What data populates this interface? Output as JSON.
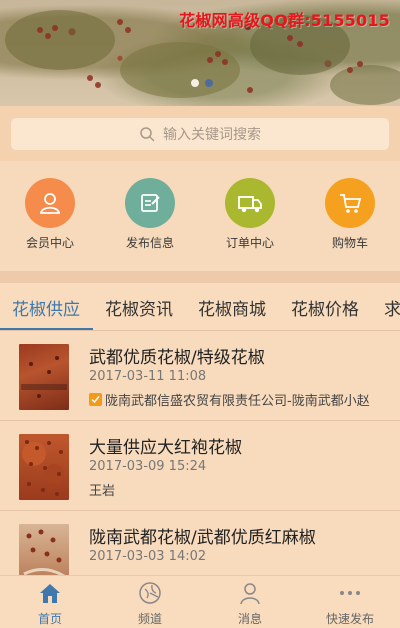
{
  "banner": {
    "text": "花椒网高级QQ群:5155015",
    "dots": [
      {
        "active": false
      },
      {
        "active": true
      }
    ]
  },
  "search": {
    "placeholder": "输入关键词搜索"
  },
  "quick_actions": [
    {
      "label": "会员中心",
      "icon": "user-icon",
      "color": "#f58c4c"
    },
    {
      "label": "发布信息",
      "icon": "edit-icon",
      "color": "#6fae9a"
    },
    {
      "label": "订单中心",
      "icon": "truck-icon",
      "color": "#a9b82e"
    },
    {
      "label": "购物车",
      "icon": "cart-icon",
      "color": "#f6a01f"
    }
  ],
  "tabs": {
    "items": [
      "花椒供应",
      "花椒资讯",
      "花椒商城",
      "花椒价格",
      "求"
    ],
    "active_index": 0,
    "accent": "#3e78ad"
  },
  "list": [
    {
      "title": "武都优质花椒/特级花椒",
      "date": "2017-03-11 11:08",
      "meta": "陇南武都信盛农贸有限责任公司-陇南武都小赵",
      "verified": true
    },
    {
      "title": "大量供应大红袍花椒",
      "date": "2017-03-09 15:24",
      "meta": "王岩",
      "verified": false
    },
    {
      "title": "陇南武都花椒/武都优质红麻椒",
      "date": "2017-03-03 14:02",
      "meta": "",
      "verified": false
    }
  ],
  "bottom_nav": [
    {
      "label": "首页",
      "icon": "home-icon",
      "active": true
    },
    {
      "label": "频道",
      "icon": "compass-icon",
      "active": false
    },
    {
      "label": "消息",
      "icon": "user-icon",
      "active": false
    },
    {
      "label": "快速发布",
      "icon": "more-icon",
      "active": false
    }
  ]
}
